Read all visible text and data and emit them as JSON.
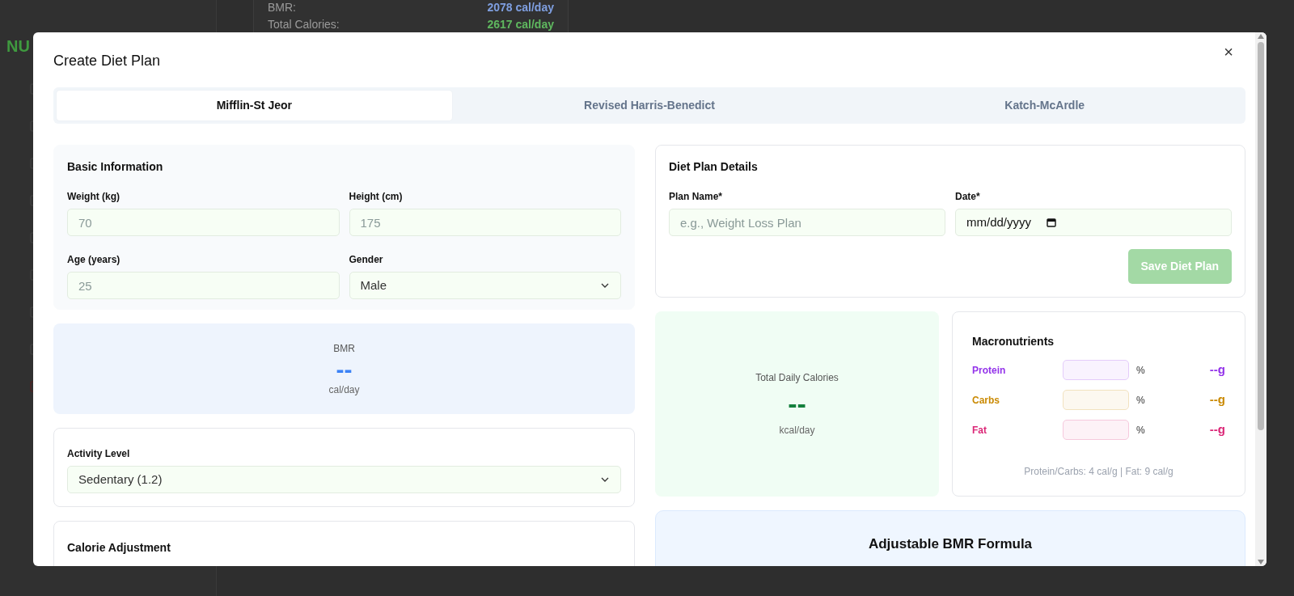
{
  "background": {
    "brand": "NU",
    "summary": [
      {
        "label": "BMR:",
        "value": "2078 cal/day",
        "kind": "bmr"
      },
      {
        "label": "Total Calories:",
        "value": "2617 cal/day",
        "kind": "total"
      }
    ]
  },
  "modal": {
    "title": "Create Diet Plan",
    "close": "×",
    "tabs": [
      {
        "label": "Mifflin-St Jeor",
        "selected": true
      },
      {
        "label": "Revised Harris-Benedict",
        "selected": false
      },
      {
        "label": "Katch-McArdle",
        "selected": false
      }
    ],
    "basic_info": {
      "title": "Basic Information",
      "fields": [
        {
          "label": "Weight (kg)",
          "placeholder": "70",
          "kind": "input"
        },
        {
          "label": "Height (cm)",
          "placeholder": "175",
          "kind": "input"
        },
        {
          "label": "Age (years)",
          "placeholder": "25",
          "kind": "input"
        },
        {
          "label": "Gender",
          "value": "Male",
          "kind": "select"
        }
      ]
    },
    "bmr": {
      "label": "BMR",
      "value": "--",
      "unit": "cal/day"
    },
    "activity": {
      "label": "Activity Level",
      "value": "Sedentary (1.2)"
    },
    "calorie_adjustment": {
      "title": "Calorie Adjustment"
    },
    "plan_details": {
      "title": "Diet Plan Details",
      "fields": [
        {
          "label": "Plan Name*",
          "placeholder": "e.g., Weight Loss Plan",
          "kind": "text"
        },
        {
          "label": "Date*",
          "placeholder": "mm/dd/yyyy",
          "kind": "date"
        }
      ],
      "save_button": {
        "label": "Save Diet Plan",
        "disabled": true
      }
    },
    "total_calories": {
      "label": "Total Daily Calories",
      "value": "--",
      "unit": "kcal/day"
    },
    "macronutrients": {
      "title": "Macronutrients",
      "items": [
        {
          "name": "Protein",
          "unit": "%",
          "amount": "--g",
          "color": "#9333ea"
        },
        {
          "name": "Carbs",
          "unit": "%",
          "amount": "--g",
          "color": "#ca8a04"
        },
        {
          "name": "Fat",
          "unit": "%",
          "amount": "--g",
          "color": "#db2777"
        }
      ],
      "note": "Protein/Carbs: 4 cal/g | Fat: 9 cal/g"
    },
    "adjustable_formula": {
      "title": "Adjustable BMR Formula"
    }
  }
}
